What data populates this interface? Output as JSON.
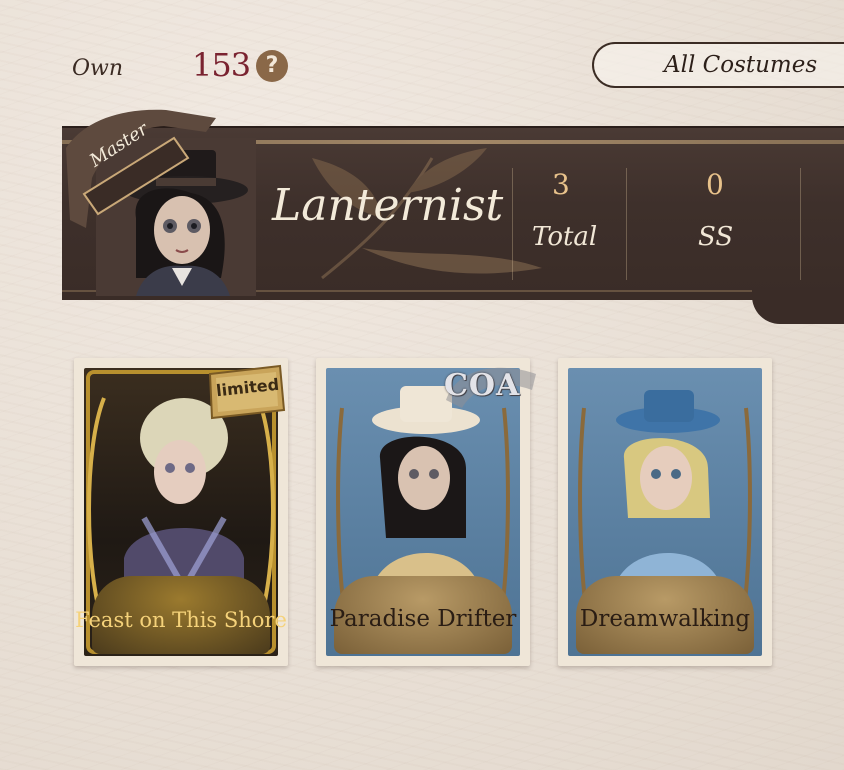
{
  "own": {
    "label": "Own",
    "count": "153"
  },
  "filter": {
    "label": "All Costumes"
  },
  "banner": {
    "rank": "Master",
    "name": "Lanternist",
    "stats": [
      {
        "value": "3",
        "label": "Total"
      },
      {
        "value": "0",
        "label": "SS"
      }
    ]
  },
  "costumes": [
    {
      "name": "Feast on This Shore",
      "badge": "limited",
      "theme": "gold"
    },
    {
      "name": "Paradise Drifter",
      "badge": "COA",
      "theme": "blue"
    },
    {
      "name": "Dreamwalking",
      "badge": "",
      "theme": "blue"
    }
  ],
  "colors": {
    "accent_count": "#7a2330",
    "banner_bg": "#3e302b",
    "stat_value": "#e8c28b",
    "card_blue": "#5c82a6",
    "card_gold": "#2a2218"
  }
}
